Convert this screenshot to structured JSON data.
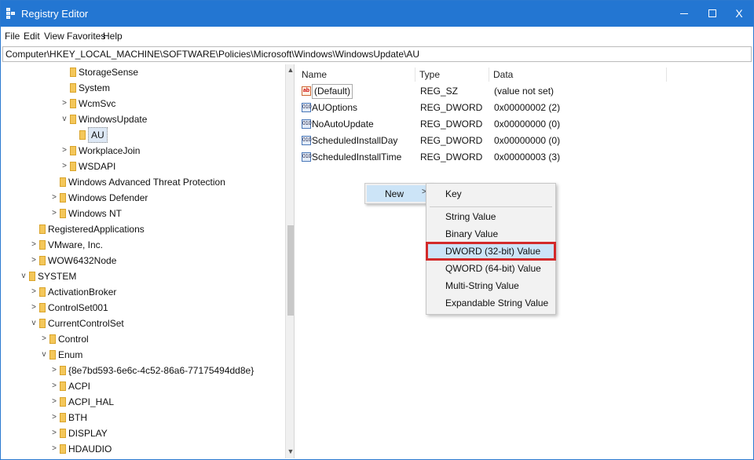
{
  "window": {
    "title": "Registry Editor",
    "controls": {
      "minimize": "",
      "maximize": "",
      "close": "X"
    }
  },
  "menu": [
    "File",
    "Edit",
    "View",
    "Favorites",
    "Help"
  ],
  "address": "Computer\\HKEY_LOCAL_MACHINE\\SOFTWARE\\Policies\\Microsoft\\Windows\\WindowsUpdate\\AU",
  "tree": [
    {
      "label": "StorageSense",
      "expander": ""
    },
    {
      "label": "System",
      "expander": ""
    },
    {
      "label": "WcmSvc",
      "expander": ">"
    },
    {
      "label": "WindowsUpdate",
      "expander": "v"
    },
    {
      "label": "AU",
      "expander": "",
      "selected": true
    },
    {
      "label": "WorkplaceJoin",
      "expander": ">"
    },
    {
      "label": "WSDAPI",
      "expander": ">"
    },
    {
      "label": "Windows Advanced Threat Protection",
      "expander": ""
    },
    {
      "label": "Windows Defender",
      "expander": ">"
    },
    {
      "label": "Windows NT",
      "expander": ">"
    },
    {
      "label": "RegisteredApplications",
      "expander": ""
    },
    {
      "label": "VMware, Inc.",
      "expander": ">"
    },
    {
      "label": "WOW6432Node",
      "expander": ">"
    },
    {
      "label": "SYSTEM",
      "expander": "v"
    },
    {
      "label": "ActivationBroker",
      "expander": ">"
    },
    {
      "label": "ControlSet001",
      "expander": ">"
    },
    {
      "label": "CurrentControlSet",
      "expander": "v"
    },
    {
      "label": "Control",
      "expander": ">"
    },
    {
      "label": "Enum",
      "expander": "v"
    },
    {
      "label": "{8e7bd593-6e6c-4c52-86a6-77175494dd8e}",
      "expander": ">"
    },
    {
      "label": "ACPI",
      "expander": ">"
    },
    {
      "label": "ACPI_HAL",
      "expander": ">"
    },
    {
      "label": "BTH",
      "expander": ">"
    },
    {
      "label": "DISPLAY",
      "expander": ">"
    },
    {
      "label": "HDAUDIO",
      "expander": ">"
    }
  ],
  "values_header": {
    "name": "Name",
    "type": "Type",
    "data": "Data"
  },
  "values": [
    {
      "icon": "ab",
      "name": "(Default)",
      "type": "REG_SZ",
      "data": "(value not set)"
    },
    {
      "icon": "dword",
      "name": "AUOptions",
      "type": "REG_DWORD",
      "data": "0x00000002 (2)"
    },
    {
      "icon": "dword",
      "name": "NoAutoUpdate",
      "type": "REG_DWORD",
      "data": "0x00000000 (0)"
    },
    {
      "icon": "dword",
      "name": "ScheduledInstallDay",
      "type": "REG_DWORD",
      "data": "0x00000000 (0)"
    },
    {
      "icon": "dword",
      "name": "ScheduledInstallTime",
      "type": "REG_DWORD",
      "data": "0x00000003 (3)"
    }
  ],
  "context_menu": {
    "new_label": "New",
    "new_arrow": ">",
    "submenu": [
      "Key",
      "String Value",
      "Binary Value",
      "DWORD (32-bit) Value",
      "QWORD (64-bit) Value",
      "Multi-String Value",
      "Expandable String Value"
    ],
    "highlighted": "DWORD (32-bit) Value"
  },
  "colors": {
    "titlebar": "#2376d2",
    "highlight_outline": "#d22a2a",
    "menu_hover": "#cce4f7"
  }
}
